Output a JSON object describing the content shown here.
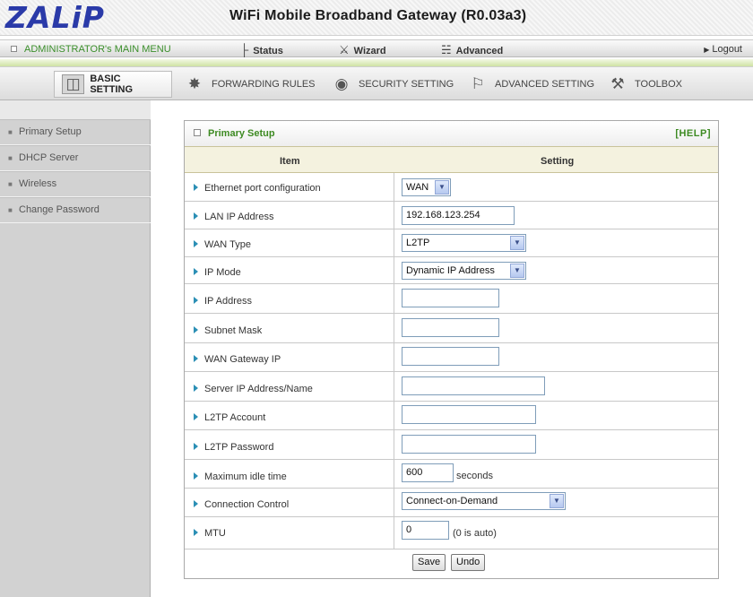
{
  "header": {
    "logo": "ZALiP",
    "title": "WiFi Mobile Broadband Gateway (R0.03a3)"
  },
  "menubar": {
    "admin_menu": "ADMINISTRATOR's MAIN MENU",
    "items": [
      {
        "label": "Status",
        "icon": "status-icon"
      },
      {
        "label": "Wizard",
        "icon": "wizard-icon"
      },
      {
        "label": "Advanced",
        "icon": "advanced-icon"
      }
    ],
    "logout": "Logout"
  },
  "tabs": [
    {
      "label": "BASIC SETTING",
      "icon": "basic-setting-icon",
      "active": true
    },
    {
      "label": "FORWARDING RULES",
      "icon": "forwarding-rules-icon",
      "active": false
    },
    {
      "label": "SECURITY SETTING",
      "icon": "security-setting-icon",
      "active": false
    },
    {
      "label": "ADVANCED SETTING",
      "icon": "advanced-setting-icon",
      "active": false
    },
    {
      "label": "TOOLBOX",
      "icon": "toolbox-icon",
      "active": false
    }
  ],
  "sidebar": {
    "items": [
      {
        "label": "Primary Setup"
      },
      {
        "label": "DHCP Server"
      },
      {
        "label": "Wireless"
      },
      {
        "label": "Change Password"
      }
    ]
  },
  "panel": {
    "title": "Primary Setup",
    "help": "[HELP]",
    "col_item": "Item",
    "col_setting": "Setting"
  },
  "form": {
    "ethernet_port": {
      "label": "Ethernet port configuration",
      "value": "WAN"
    },
    "lan_ip": {
      "label": "LAN IP Address",
      "value": "192.168.123.254"
    },
    "wan_type": {
      "label": "WAN Type",
      "value": "L2TP"
    },
    "ip_mode": {
      "label": "IP Mode",
      "value": "Dynamic IP Address"
    },
    "ip_address": {
      "label": "IP Address",
      "value": ""
    },
    "subnet_mask": {
      "label": "Subnet Mask",
      "value": ""
    },
    "wan_gateway": {
      "label": "WAN Gateway IP",
      "value": ""
    },
    "server_ip": {
      "label": "Server IP Address/Name",
      "value": ""
    },
    "l2tp_account": {
      "label": "L2TP Account",
      "value": ""
    },
    "l2tp_password": {
      "label": "L2TP Password",
      "value": ""
    },
    "max_idle": {
      "label": "Maximum idle time",
      "value": "600",
      "unit": "seconds"
    },
    "connection_control": {
      "label": "Connection Control",
      "value": "Connect-on-Demand"
    },
    "mtu": {
      "label": "MTU",
      "value": "0",
      "unit": "(0 is auto)"
    }
  },
  "buttons": {
    "save": "Save",
    "undo": "Undo"
  }
}
